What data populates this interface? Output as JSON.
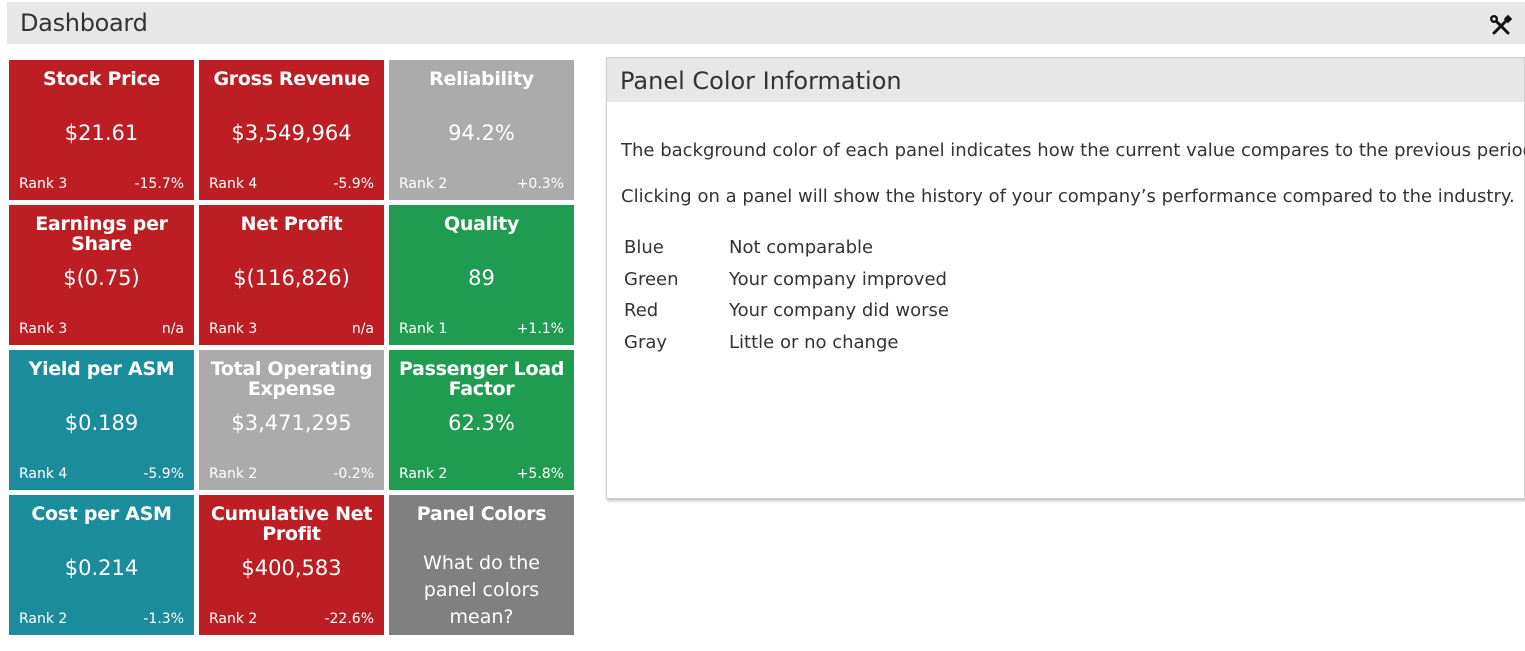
{
  "header": {
    "title": "Dashboard",
    "tools_icon": "wrench-screwdriver-icon"
  },
  "tiles": [
    {
      "title": "Stock Price",
      "value": "$21.61",
      "rank": "Rank 3",
      "change": "-15.7%",
      "color": "red"
    },
    {
      "title": "Gross Revenue",
      "value": "$3,549,964",
      "rank": "Rank 4",
      "change": "-5.9%",
      "color": "red"
    },
    {
      "title": "Reliability",
      "value": "94.2%",
      "rank": "Rank 2",
      "change": "+0.3%",
      "color": "gray"
    },
    {
      "title": "Earnings per Share",
      "value": "$(0.75)",
      "rank": "Rank 3",
      "change": "n/a",
      "color": "red"
    },
    {
      "title": "Net Profit",
      "value": "$(116,826)",
      "rank": "Rank 3",
      "change": "n/a",
      "color": "red"
    },
    {
      "title": "Quality",
      "value": "89",
      "rank": "Rank 1",
      "change": "+1.1%",
      "color": "green"
    },
    {
      "title": "Yield per ASM",
      "value": "$0.189",
      "rank": "Rank 4",
      "change": "-5.9%",
      "color": "teal"
    },
    {
      "title": "Total Operating Expense",
      "value": "$3,471,295",
      "rank": "Rank 2",
      "change": "-0.2%",
      "color": "gray"
    },
    {
      "title": "Passenger Load Factor",
      "value": "62.3%",
      "rank": "Rank 2",
      "change": "+5.8%",
      "color": "green"
    },
    {
      "title": "Cost per ASM",
      "value": "$0.214",
      "rank": "Rank 2",
      "change": "-1.3%",
      "color": "teal"
    },
    {
      "title": "Cumulative Net Profit",
      "value": "$400,583",
      "rank": "Rank 2",
      "change": "-22.6%",
      "color": "red"
    }
  ],
  "help_tile": {
    "title": "Panel Colors",
    "text": "What do the panel colors mean?",
    "color": "darkgray"
  },
  "colors": {
    "red": "#bd1e24",
    "gray": "#ababab",
    "green": "#1f9c50",
    "teal": "#1a8c9c",
    "darkgray": "#808080"
  },
  "info_panel": {
    "title": "Panel Color Information",
    "paragraph1": "The background color of each panel indicates how the current value compares to the previous period.",
    "paragraph2": "Clicking on a panel will show the history of your company’s performance compared to the industry.",
    "legend": [
      {
        "key": "Blue",
        "value": "Not comparable"
      },
      {
        "key": "Green",
        "value": "Your company improved"
      },
      {
        "key": "Red",
        "value": "Your company did worse"
      },
      {
        "key": "Gray",
        "value": "Little or no change"
      }
    ]
  }
}
